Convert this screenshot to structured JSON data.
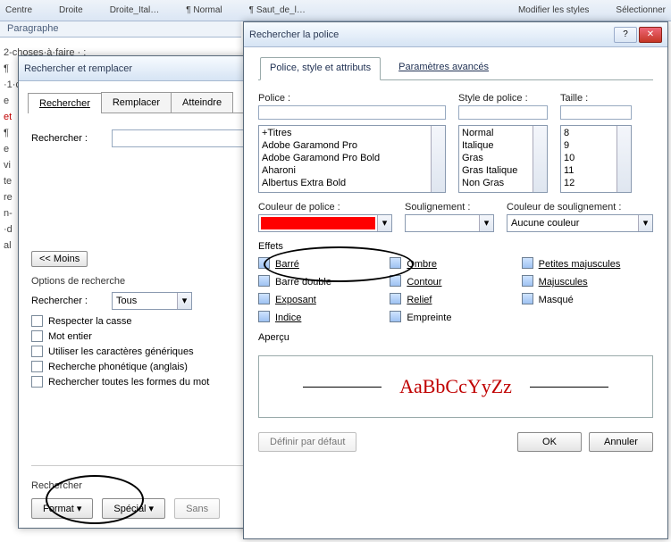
{
  "ribbon": {
    "centre": "Centre",
    "droite": "Droite",
    "droite_ital": "Droite_Ital…",
    "normal": "¶ Normal",
    "saut": "¶ Saut_de_l…",
    "modifier": "Modifier les styles",
    "selectionner": "Sélectionner"
  },
  "paragraphe_label": "Paragraphe",
  "doc": {
    "l1": "2-choses·à·faire · :",
    "l2": "¶",
    "l3": "·1·c",
    "l4": "e",
    "l5": "et",
    "l6": "¶",
    "l7": "e",
    "l8": "vi",
    "l9": "te",
    "l10": "re",
    "l11": "n-",
    "l12": "·d",
    "l13": "al"
  },
  "dlg1": {
    "title": "Rechercher et remplacer",
    "tab_rechercher": "Rechercher",
    "tab_remplacer": "Remplacer",
    "tab_atteindre": "Atteindre",
    "lbl_rechercher": "Rechercher :",
    "input_value": "",
    "btn_moins": "<< Moins",
    "lbl_options": "Options de recherche",
    "lbl_rechercher2": "Rechercher :",
    "combo_tous": "Tous",
    "cb_casse": "Respecter la casse",
    "cb_motentier": "Mot entier",
    "cb_generiques": "Utiliser les caractères génériques",
    "cb_phon": "Recherche phonétique (anglais)",
    "cb_formes": "Rechercher toutes les formes du mot",
    "lbl_bottom": "Rechercher",
    "btn_format": "Format",
    "btn_special": "Spécial",
    "btn_sans": "Sans"
  },
  "dlg2": {
    "title": "Rechercher la police",
    "tab_police": "Police, style et attributs",
    "tab_param": "Paramètres avancés",
    "lbl_police": "Police :",
    "lbl_style": "Style de police :",
    "lbl_taille": "Taille :",
    "police_input": "",
    "style_input": "",
    "taille_input": "",
    "police_list": [
      "+Titres",
      "Adobe Garamond Pro",
      "Adobe Garamond Pro Bold",
      "Aharoni",
      "Albertus Extra Bold"
    ],
    "style_list": [
      "Normal",
      "Italique",
      "Gras",
      "Gras Italique",
      "Non Gras"
    ],
    "taille_list": [
      "8",
      "9",
      "10",
      "11",
      "12"
    ],
    "lbl_couleur": "Couleur de police :",
    "lbl_soulign": "Soulignement :",
    "lbl_coul_soulign": "Couleur de soulignement :",
    "combo_soulign": "",
    "combo_coul_soulign": "Aucune couleur",
    "lbl_effets": "Effets",
    "cb_barre": "Barré",
    "cb_barre_dbl": "Barré double",
    "cb_exposant": "Exposant",
    "cb_indice": "Indice",
    "cb_ombre": "Ombre",
    "cb_contour": "Contour",
    "cb_relief": "Relief",
    "cb_empreinte": "Empreinte",
    "cb_petites": "Petites majuscules",
    "cb_maj": "Majuscules",
    "cb_masque": "Masqué",
    "lbl_apercu": "Aperçu",
    "sample": "AaBbCcYyZz",
    "btn_defaut": "Définir par défaut",
    "btn_ok": "OK",
    "btn_annuler": "Annuler"
  },
  "colors": {
    "font_color": "#ff0000"
  }
}
